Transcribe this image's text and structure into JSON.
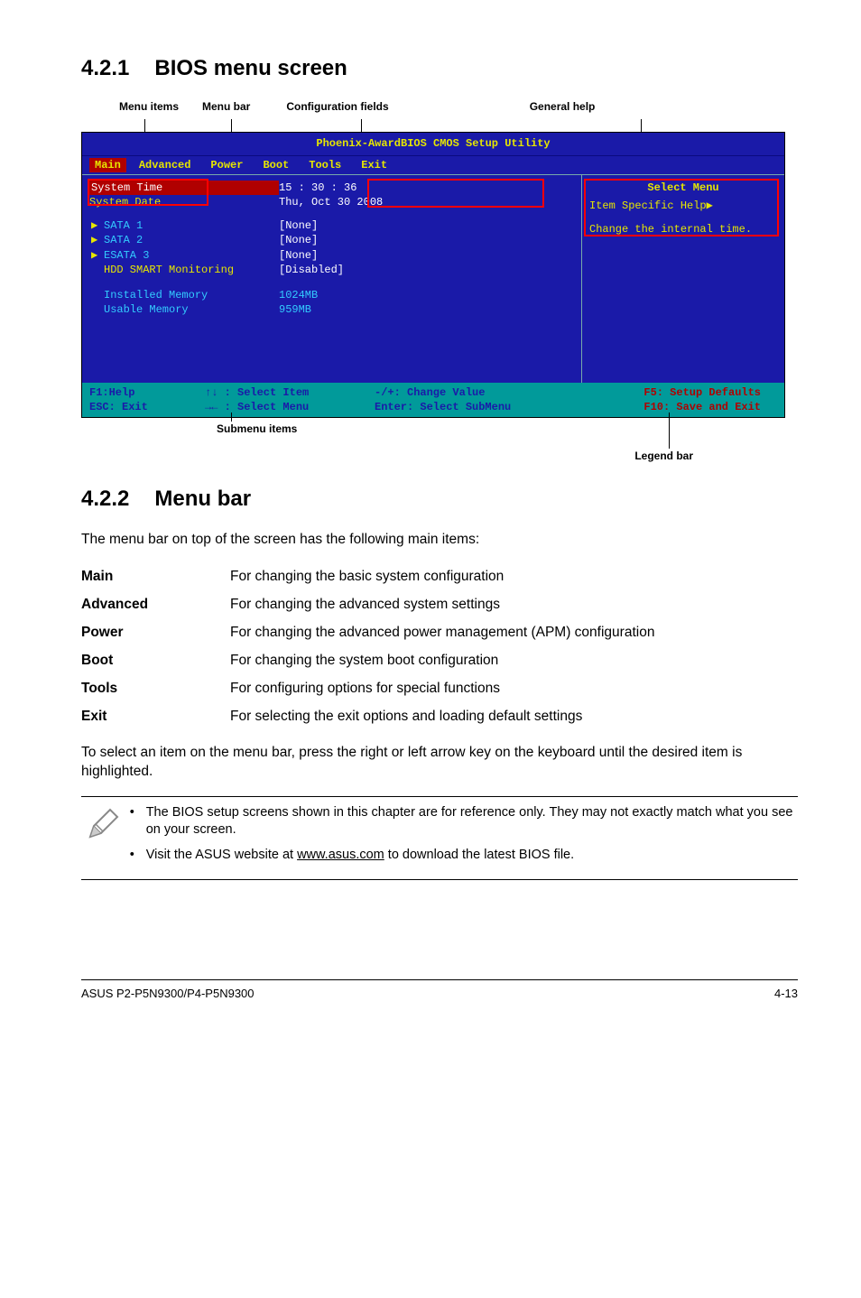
{
  "sections": {
    "s1": {
      "num": "4.2.1",
      "title": "BIOS menu screen"
    },
    "s2": {
      "num": "4.2.2",
      "title": "Menu bar"
    }
  },
  "annot": {
    "menuitems": "Menu items",
    "menubar": "Menu bar",
    "config": "Configuration fields",
    "general": "General help",
    "submenu": "Submenu items",
    "legend": "Legend bar"
  },
  "bios": {
    "title": "Phoenix-AwardBIOS CMOS Setup Utility",
    "tabs": {
      "main": "Main",
      "advanced": "Advanced",
      "power": "Power",
      "boot": "Boot",
      "tools": "Tools",
      "exit": "Exit"
    },
    "left": {
      "system_time_lbl": "System Time",
      "system_time_val": "15 : 30 : 36",
      "system_date_lbl": "System Date",
      "system_date_val": "Thu, Oct 30 2008",
      "sata1_lbl": "SATA 1",
      "sata1_val": "[None]",
      "sata2_lbl": "SATA 2",
      "sata2_val": "[None]",
      "esata3_lbl": "ESATA 3",
      "esata3_val": "[None]",
      "hdd_lbl": "HDD SMART Monitoring",
      "hdd_val": "[Disabled]",
      "inst_lbl": "Installed Memory",
      "inst_val": "1024MB",
      "usable_lbl": "Usable Memory",
      "usable_val": "959MB"
    },
    "right": {
      "title": "Select Menu",
      "sub": "Item Specific Help▶",
      "body": "Change the internal time."
    },
    "legend": {
      "c1a": "F1:Help",
      "c1b": "ESC: Exit",
      "c2a": "↑↓ : Select Item",
      "c2b": "→← : Select Menu",
      "c3a": "-/+: Change Value",
      "c3b": "Enter: Select SubMenu",
      "c4a": "F5: Setup Defaults",
      "c4b": "F10: Save and Exit"
    }
  },
  "s2": {
    "intro": "The menu bar on top of the screen has the following main items:",
    "rows": {
      "main_k": "Main",
      "main_v": "For changing the basic system configuration",
      "adv_k": "Advanced",
      "adv_v": "For changing the advanced system settings",
      "pow_k": "Power",
      "pow_v": "For changing the advanced power management (APM) configuration",
      "boot_k": "Boot",
      "boot_v": "For changing the system boot configuration",
      "tools_k": "Tools",
      "tools_v": "For configuring options for special functions",
      "exit_k": "Exit",
      "exit_v": "For selecting the exit options and loading default settings"
    },
    "outro": "To select an item on the menu bar, press the right or left arrow key on the keyboard until the desired item is highlighted.",
    "notes": {
      "n1": "The BIOS setup screens shown in this chapter are for reference only. They may not exactly match what you see on your screen.",
      "n2a": "Visit the ASUS website at ",
      "n2b": "www.asus.com",
      "n2c": " to download the latest BIOS file."
    }
  },
  "footer": {
    "left": "ASUS P2-P5N9300/P4-P5N9300",
    "right": "4-13"
  }
}
